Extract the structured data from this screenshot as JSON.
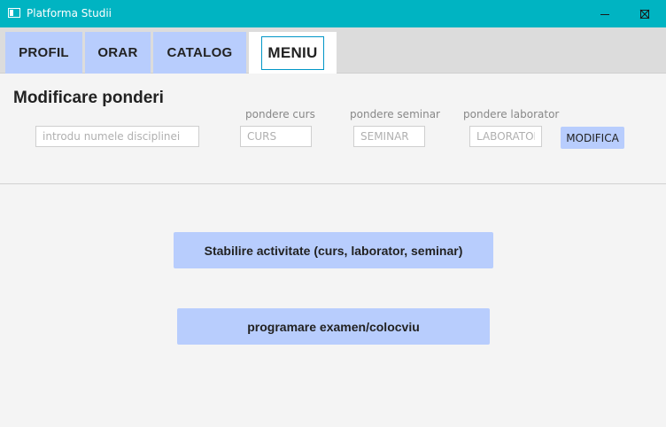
{
  "window": {
    "title": "Platforma Studii"
  },
  "tabs": [
    "PROFIL",
    "ORAR",
    "CATALOG",
    "MENIU"
  ],
  "section": {
    "title": "Modificare ponderi",
    "discipline_placeholder": "introdu numele disciplinei",
    "curs_label": "pondere curs",
    "curs_placeholder": "CURS",
    "seminar_label": "pondere seminar",
    "seminar_placeholder": "SEMINAR",
    "laborator_label": "pondere laborator",
    "laborator_placeholder": "LABORATOR",
    "modify_button": "MODIFICA"
  },
  "actions": {
    "activity_button": "Stabilire activitate (curs, laborator, seminar)",
    "exam_button": "programare examen/colocviu"
  },
  "colors": {
    "titlebar": "#00b4c2",
    "accent_button": "#b8cdfd",
    "active_tab_border": "#0096c7"
  }
}
